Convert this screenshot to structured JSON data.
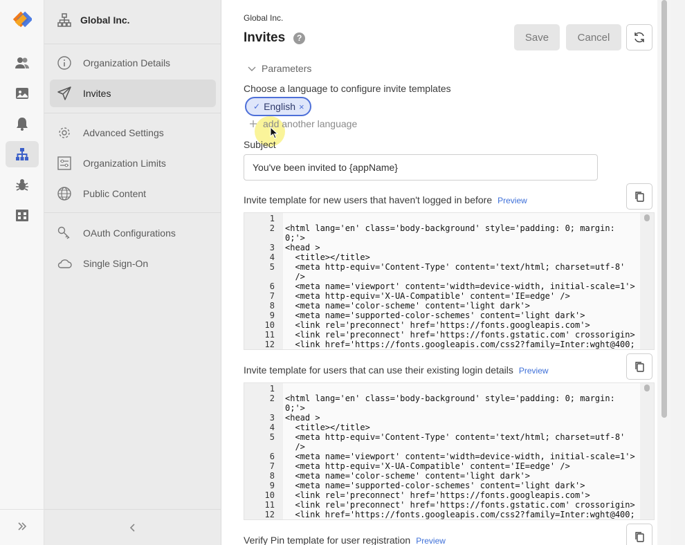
{
  "rail": {
    "items": [
      {
        "icon": "users-icon"
      },
      {
        "icon": "image-icon"
      },
      {
        "icon": "bell-icon"
      },
      {
        "icon": "org-hierarchy-icon",
        "active": true
      },
      {
        "icon": "bug-icon"
      },
      {
        "icon": "store-icon"
      }
    ],
    "expand_icon": "double-chevron-right-icon",
    "accent": "#f07a1a"
  },
  "nav": {
    "org_name": "Global Inc.",
    "items": [
      {
        "label": "Organization Details",
        "icon": "info-icon"
      },
      {
        "label": "Invites",
        "icon": "paper-plane-icon",
        "active": true
      },
      {
        "label": "Advanced Settings",
        "icon": "gear-icon"
      },
      {
        "label": "Organization Limits",
        "icon": "limits-icon"
      },
      {
        "label": "Public Content",
        "icon": "globe-icon"
      },
      {
        "label": "OAuth Configurations",
        "icon": "key-icon"
      },
      {
        "label": "Single Sign-On",
        "icon": "cloud-icon"
      }
    ],
    "collapse_icon": "chevron-left-icon"
  },
  "header": {
    "breadcrumb": "Global Inc.",
    "title": "Invites",
    "help": "?",
    "save_label": "Save",
    "cancel_label": "Cancel"
  },
  "form": {
    "parameters_label": "Parameters",
    "language_prompt": "Choose a language to configure invite templates",
    "language_chip": "English",
    "chip_check": "✓",
    "chip_remove": "×",
    "add_language": "add another language",
    "subject_label": "Subject",
    "subject_value": "You've been invited to {appName}",
    "preview_label": "Preview",
    "template_new_label": "Invite template for new users that haven't logged in before",
    "template_existing_label": "Invite template for users that can use their existing login details",
    "template_pin_label": "Verify Pin template for user registration"
  },
  "code_lines": [
    {
      "n": "1",
      "t": ""
    },
    {
      "n": "2",
      "t": "<html lang='en' class='body-background' style='padding: 0; margin:"
    },
    {
      "n": "",
      "t": "0;'>"
    },
    {
      "n": "3",
      "t": "<head >"
    },
    {
      "n": "4",
      "t": "  <title></title>"
    },
    {
      "n": "5",
      "t": "  <meta http-equiv='Content-Type' content='text/html; charset=utf-8'"
    },
    {
      "n": "",
      "t": "  />"
    },
    {
      "n": "6",
      "t": "  <meta name='viewport' content='width=device-width, initial-scale=1'>"
    },
    {
      "n": "7",
      "t": "  <meta http-equiv='X-UA-Compatible' content='IE=edge' />"
    },
    {
      "n": "8",
      "t": "  <meta name='color-scheme' content='light dark'>"
    },
    {
      "n": "9",
      "t": "  <meta name='supported-color-schemes' content='light dark'>"
    },
    {
      "n": "10",
      "t": "  <link rel='preconnect' href='https://fonts.googleapis.com'>"
    },
    {
      "n": "11",
      "t": "  <link rel='preconnect' href='https://fonts.gstatic.com' crossorigin>"
    },
    {
      "n": "12",
      "t": "  <link href='https://fonts.googleapis.com/css2?family=Inter:wght@400;"
    }
  ]
}
